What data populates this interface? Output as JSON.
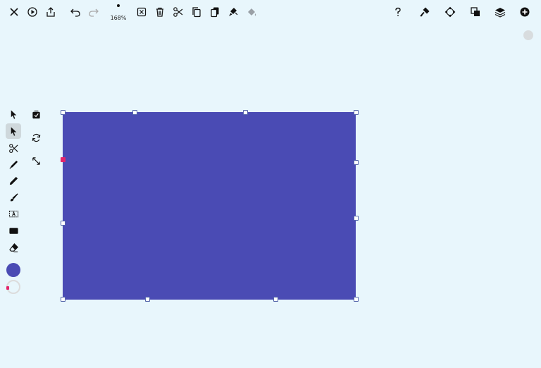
{
  "toolbar": {
    "zoom_label": "168%"
  },
  "colors": {
    "fill": "#4a4bb4",
    "stroke_swatch": "#e0a0b0",
    "background": "#e8f6fc"
  },
  "left_toolbar": {
    "tools": [
      "select-arrow",
      "direct-select",
      "scissors",
      "pen",
      "pencil",
      "brush",
      "text-box",
      "rectangle",
      "eraser"
    ],
    "active_tool": "direct-select"
  },
  "icons": {
    "top_left": [
      "close-icon",
      "play-icon",
      "share-icon",
      "undo-icon",
      "redo-icon"
    ],
    "top_center": [
      "delete-box-icon",
      "trash-icon",
      "cut-icon",
      "copy-icon",
      "paste-icon",
      "format-brush-icon",
      "fill-icon"
    ],
    "top_right": [
      "help-icon",
      "tool-icon",
      "diamond-icon",
      "layer-combine-icon",
      "layers-icon",
      "add-icon"
    ]
  }
}
